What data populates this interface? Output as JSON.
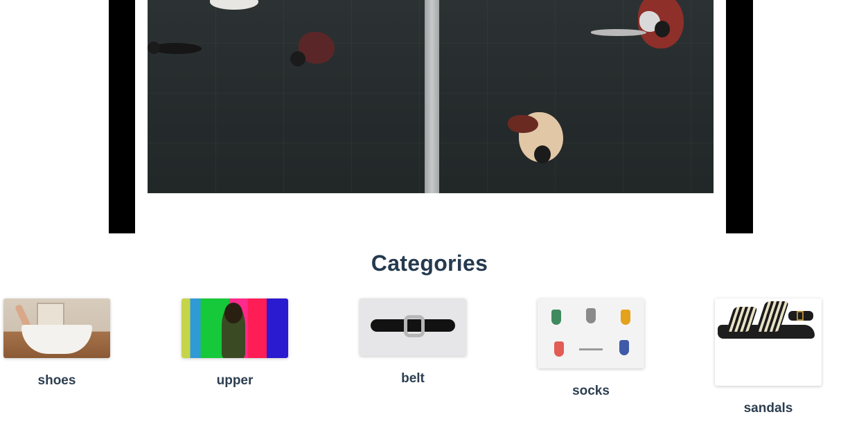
{
  "video": {
    "description_icon": "video-still-icon"
  },
  "categories": {
    "title": "Categories",
    "items": [
      {
        "label": "shoes"
      },
      {
        "label": "upper"
      },
      {
        "label": "belt"
      },
      {
        "label": "socks"
      },
      {
        "label": "sandals"
      }
    ]
  },
  "colors": {
    "heading": "#253a4f",
    "label": "#2c3e50",
    "video_frame": "#000000"
  }
}
